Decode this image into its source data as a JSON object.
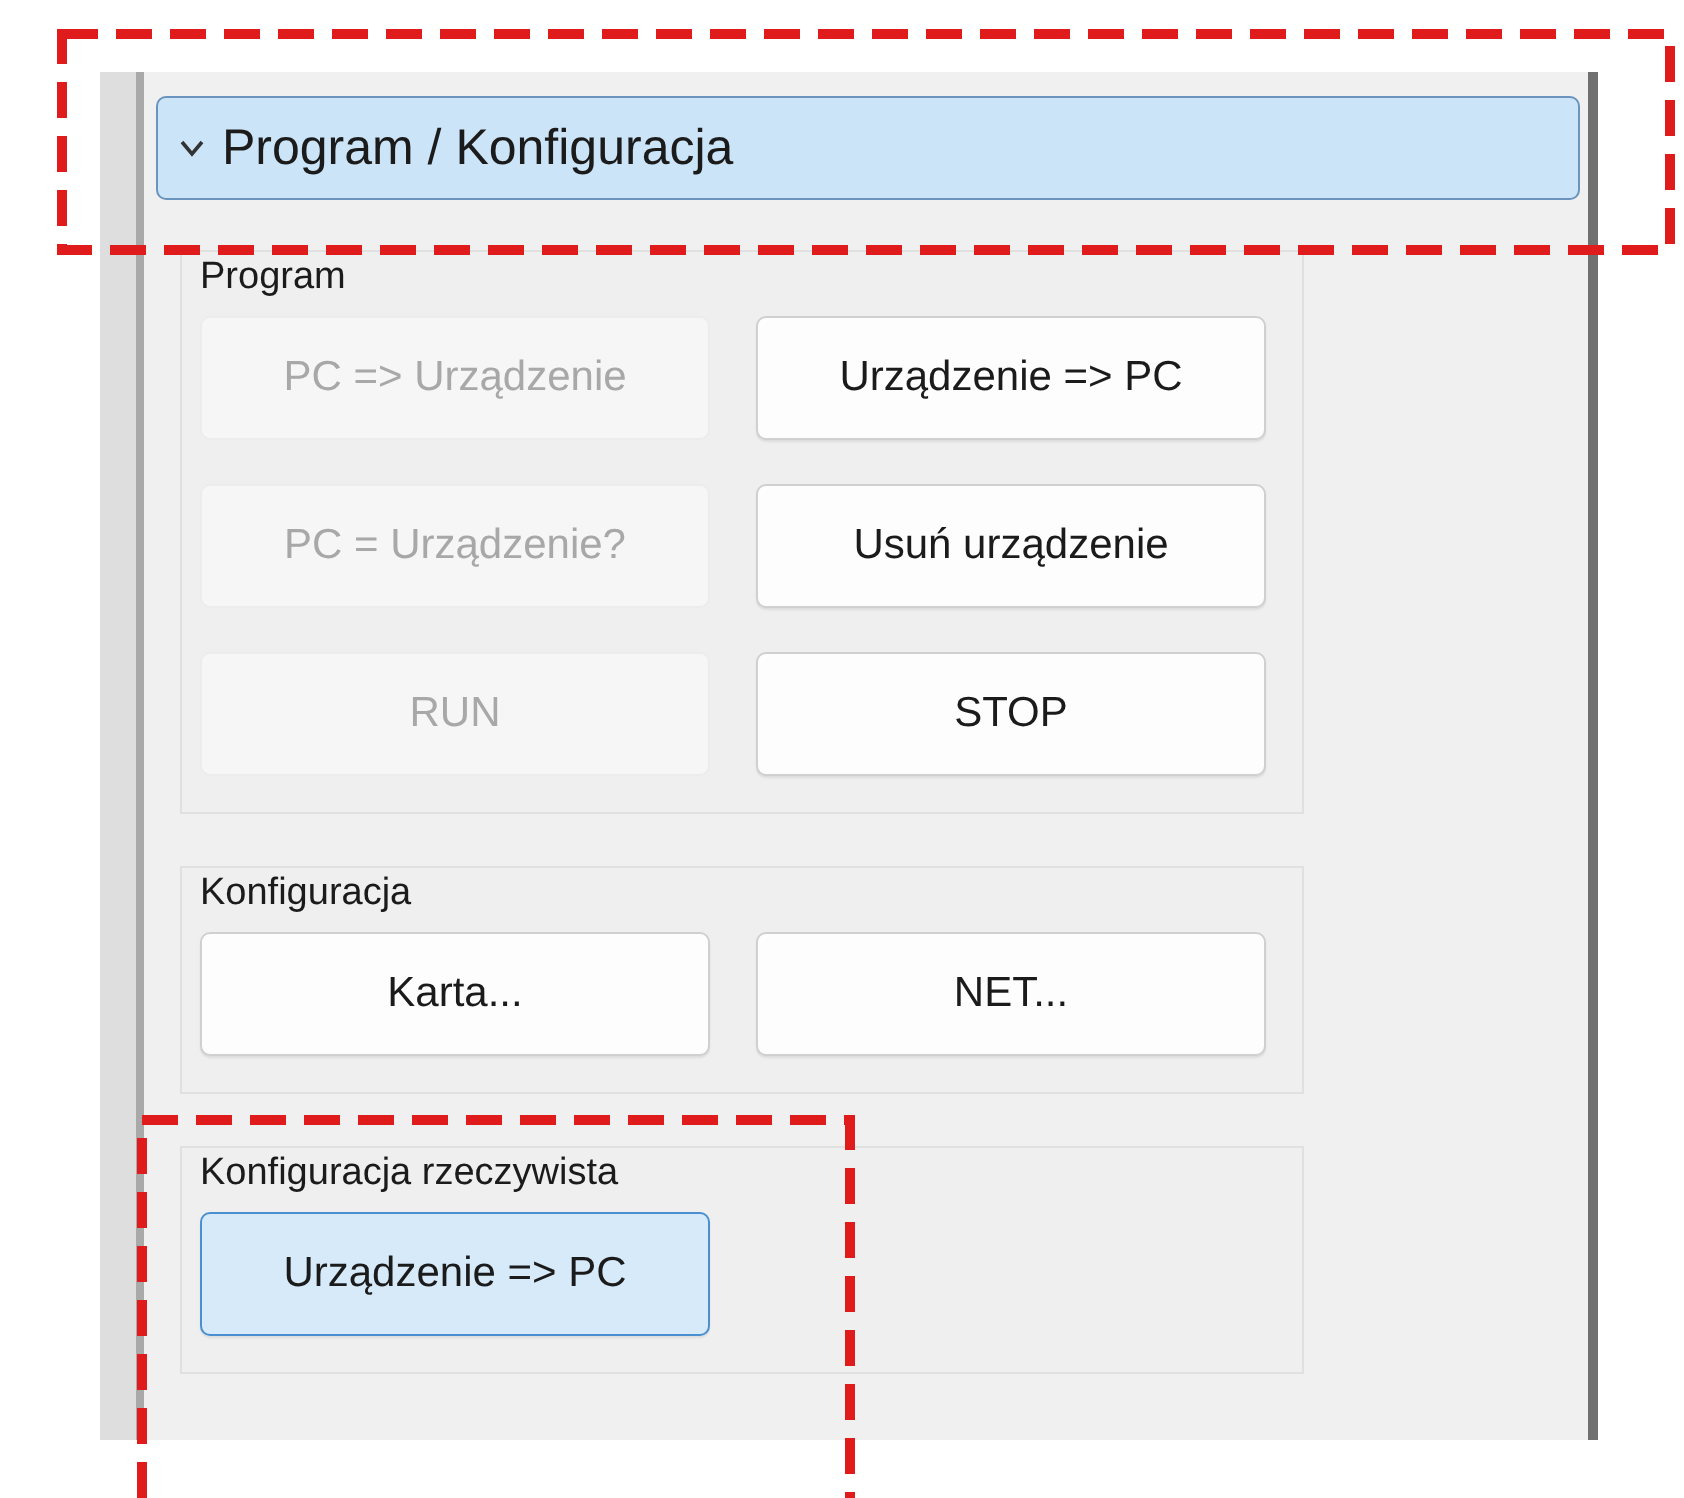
{
  "header": {
    "title": "Program / Konfiguracja",
    "expanded": true,
    "outlined": true
  },
  "groups": [
    {
      "title": "Program",
      "buttons": [
        {
          "label": "PC => Urządzenie",
          "disabled": true,
          "selected": false
        },
        {
          "label": "Urządzenie => PC",
          "disabled": false,
          "selected": false
        },
        {
          "label": "PC = Urządzenie?",
          "disabled": true,
          "selected": false
        },
        {
          "label": "Usuń urządzenie",
          "disabled": false,
          "selected": false
        },
        {
          "label": "RUN",
          "disabled": true,
          "selected": false
        },
        {
          "label": "STOP",
          "disabled": false,
          "selected": false
        }
      ]
    },
    {
      "title": "Konfiguracja",
      "buttons": [
        {
          "label": "Karta...",
          "disabled": false,
          "selected": false
        },
        {
          "label": "NET...",
          "disabled": false,
          "selected": false
        }
      ]
    },
    {
      "title": "Konfiguracja rzeczywista",
      "outlined": true,
      "buttons": [
        {
          "label": "Urządzenie => PC",
          "disabled": false,
          "selected": true
        }
      ]
    }
  ]
}
